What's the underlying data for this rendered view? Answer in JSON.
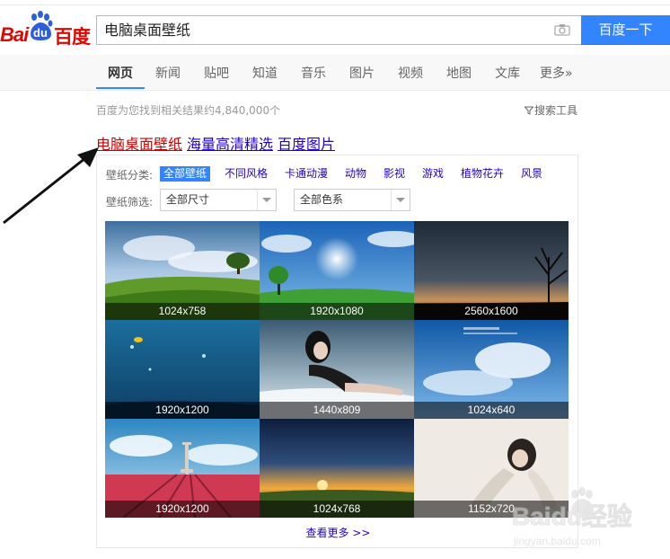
{
  "logo": {
    "bai": "Bai",
    "du": "du",
    "cn": "百度"
  },
  "search": {
    "value": "电脑桌面壁纸",
    "button_label": "百度一下"
  },
  "nav": [
    {
      "label": "网页",
      "active": true
    },
    {
      "label": "新闻"
    },
    {
      "label": "贴吧"
    },
    {
      "label": "知道"
    },
    {
      "label": "音乐"
    },
    {
      "label": "图片"
    },
    {
      "label": "视频"
    },
    {
      "label": "地图"
    },
    {
      "label": "文库"
    },
    {
      "label": "更多»"
    }
  ],
  "result_count": "百度为您找到相关结果约4,840,000个",
  "search_tools": "搜索工具",
  "result_title": {
    "part1": "电脑桌面壁纸",
    "part2": "海量高清精选",
    "part3": "百度图片"
  },
  "panel": {
    "category_label": "壁纸分类:",
    "categories": [
      "全部壁纸",
      "不同风格",
      "卡通动漫",
      "动物",
      "影视",
      "游戏",
      "植物花卉",
      "风景"
    ],
    "filter_label": "壁纸筛选:",
    "size_select": "全部尺寸",
    "color_select": "全部色系",
    "thumbs": [
      {
        "size": "1024x758",
        "icon": "green-field-tree-landscape"
      },
      {
        "size": "1920x1080",
        "icon": "blue-sky-sun-tree"
      },
      {
        "size": "2560x1600",
        "icon": "sunset-silhouette-tree"
      },
      {
        "size": "1920x1200",
        "icon": "underwater-blue-scene"
      },
      {
        "size": "1440x809",
        "icon": "woman-lying-portrait"
      },
      {
        "size": "1024x640",
        "icon": "blue-sky-clouds-heart"
      },
      {
        "size": "1920x1200",
        "icon": "tower-red-flower-field"
      },
      {
        "size": "1024x768",
        "icon": "sunset-horizon-field"
      },
      {
        "size": "1152x720",
        "icon": "woman-lying-white"
      }
    ],
    "more": "查看更多 >>"
  },
  "watermark": {
    "text": "Baidu经验",
    "url": "jingyan.baidu.com"
  },
  "colors": {
    "accent": "#3385ff",
    "brand_red": "#e10601",
    "link": "#2200cc",
    "highlight": "#cc0000"
  }
}
